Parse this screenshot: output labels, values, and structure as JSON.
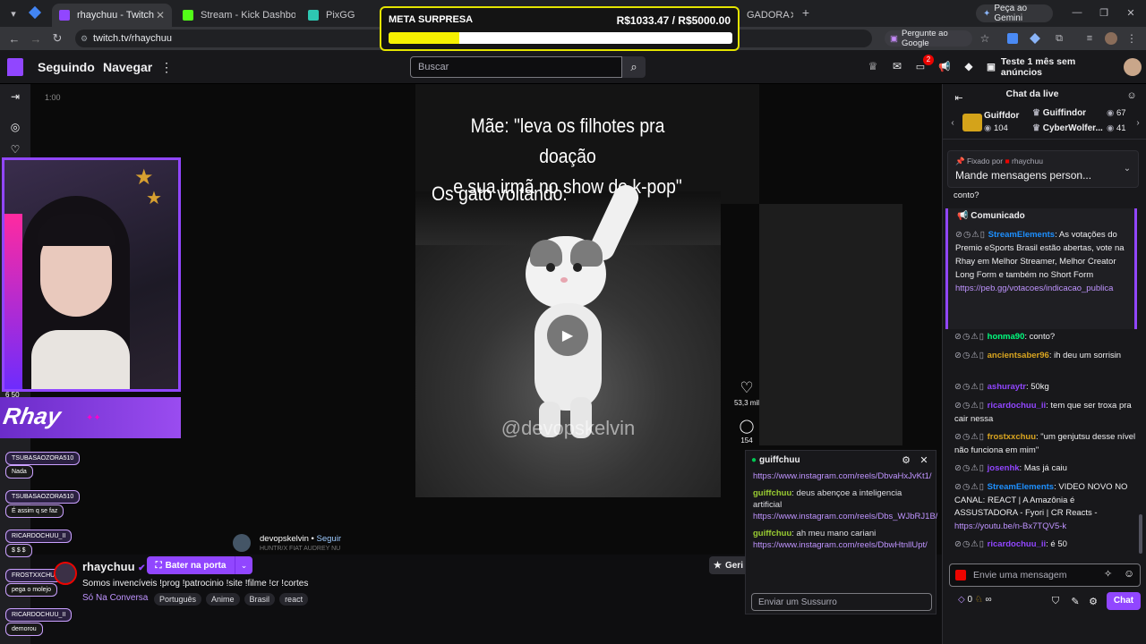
{
  "browser": {
    "tabs": [
      {
        "label": "rhaychuu - Twitch",
        "active": true,
        "color": "#9146ff"
      },
      {
        "label": "Stream - Kick Dashboard",
        "active": false,
        "color": "#53fc18"
      },
      {
        "label": "PixGG",
        "active": false,
        "color": "#2ec7b2"
      },
      {
        "label": "GADORA",
        "active": false,
        "color": "#666"
      }
    ],
    "url": "twitch.tv/rhaychuu",
    "gemini_label": "Peça ao Gemini",
    "google_label": "Pergunte ao Google"
  },
  "goal": {
    "title": "META SURPRESA",
    "value": "R$1033.47 / R$5000.00",
    "progress": 0.2067
  },
  "topnav": {
    "following": "Seguindo",
    "browse": "Navegar",
    "search_placeholder": "Buscar",
    "notif_count": "2",
    "prime_label": "Teste 1 mês sem anúncios"
  },
  "player": {
    "time": "1:00",
    "caption_line1": "Mãe: \"leva os filhotes pra doação",
    "caption_line2": "e sua irmã no show de k-pop\"",
    "caption_line3": "Os gato voltando:",
    "watermark": "@devopskelvin",
    "likes": "53,3 mil",
    "comments": "154",
    "author": "devopskelvin",
    "follow": "Seguir",
    "author_sub": "HUNTR/X  FIAT  AUDREY NU",
    "cam_counter": "6 50"
  },
  "banner": {
    "title": "Rhay"
  },
  "left_chat": [
    {
      "user": "TSUBASAOZORA510",
      "msg": "Nada"
    },
    {
      "user": "TSUBASAOZORA510",
      "msg": "É assim q se faz"
    },
    {
      "user": "RICARDOCHUU_II",
      "msg": "$ $ $"
    },
    {
      "user": "FROSTXXCHUU",
      "msg": "pega o molejo"
    },
    {
      "user": "RICARDOCHUU_II",
      "msg": "demorou"
    }
  ],
  "stream_info": {
    "channel": "rhaychuu",
    "knock_button": "Bater na porta",
    "title": "Somos invencíveis !prog !patrocinio !site !filme !cr !cortes",
    "category": "Só Na Conversa",
    "tags": [
      "Português",
      "Anime",
      "Brasil",
      "react"
    ],
    "gen_button": "Geri"
  },
  "whisper": {
    "user": "guiffchuu",
    "messages": [
      {
        "user": "guiffchuu",
        "text": "",
        "link": "https://www.instagram.com/reels/DbvaHxJvKt1/"
      },
      {
        "user": "guiffchuu",
        "text": "deus abençoe a inteligencia artificial",
        "link": "https://www.instagram.com/reels/Dbs_WJbRJ1B/"
      },
      {
        "user": "guiffchuu",
        "text": "ah meu mano cariani",
        "link": "https://www.instagram.com/reels/DbwHtnllUpt/"
      }
    ],
    "placeholder": "Enviar um Sussurro"
  },
  "chat": {
    "header": "Chat da live",
    "gifters": [
      {
        "name": "Guiffdor",
        "count": "104"
      },
      {
        "name": "Guiffindor",
        "count": "67"
      },
      {
        "name": "CyberWolfer...",
        "count": "41"
      }
    ],
    "pinned_by_label": "Fixado por",
    "pinned_by_user": "rhaychuu",
    "pinned_text": "Mande mensagens person...",
    "pinned_overflow": "conto?",
    "announcement_label": "Comunicado",
    "announcement_user": "StreamElements",
    "announcement_text": "As votações do Premio eSports Brasil estão abertas, vote na Rhay em Melhor Streamer, Melhor Creator Long Form e também no Short Form",
    "announcement_link": "https://peb.gg/votacoes/indicacao_publica",
    "messages": [
      {
        "user": "honma90",
        "color": "#00ff7f",
        "text": "conto?"
      },
      {
        "user": "ancientsaber96",
        "color": "#daa520",
        "text": "ih deu um sorrisin"
      },
      {
        "user": "ashuraytr",
        "color": "#9146ff",
        "text": "50kg"
      },
      {
        "user": "ricardochuu_ii",
        "color": "#9146ff",
        "text": "tem que ser troxa pra cair nessa"
      },
      {
        "user": "frostxxchuu",
        "color": "#daa520",
        "text": "\"um genjutsu desse nível não funciona em mim\""
      },
      {
        "user": "josenhk",
        "color": "#9146ff",
        "text": "Mas já caiu"
      },
      {
        "user": "StreamElements",
        "color": "#1e90ff",
        "text": "VIDEO NOVO NO CANAL: REACT | A Amazônia é ASSUSTADORA - Fyori | CR Reacts -",
        "link": "https://youtu.be/n-Bx7TQV5-k"
      },
      {
        "user": "ricardochuu_ii",
        "color": "#9146ff",
        "text": "é 50"
      }
    ],
    "input_placeholder": "Envie uma mensagem",
    "points": "0",
    "chat_button": "Chat",
    "accent": "#9146ff"
  }
}
